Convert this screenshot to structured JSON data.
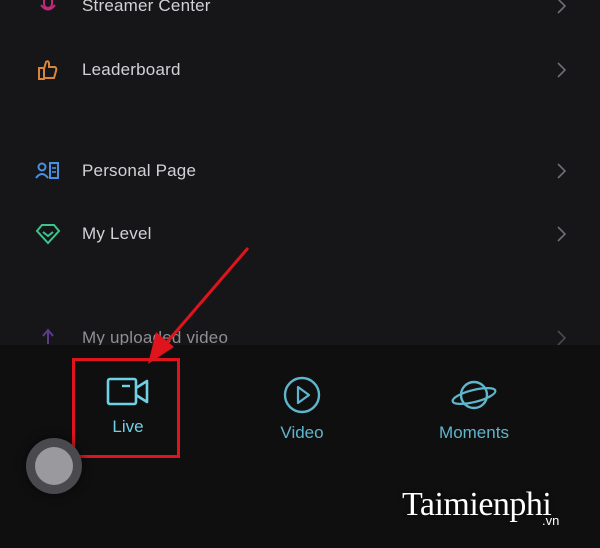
{
  "menu": {
    "items": [
      {
        "label": "Streamer Center",
        "icon": "microphone-icon"
      },
      {
        "label": "Leaderboard",
        "icon": "thumbs-up-icon"
      },
      {
        "label": "Personal Page",
        "icon": "profile-card-icon"
      },
      {
        "label": "My Level",
        "icon": "diamond-icon"
      },
      {
        "label": "My uploaded video",
        "icon": "upload-icon"
      }
    ]
  },
  "tabbar": {
    "tabs": [
      {
        "label": "Live",
        "icon": "video-camera-icon",
        "selected": true
      },
      {
        "label": "Video",
        "icon": "play-circle-icon",
        "selected": false
      },
      {
        "label": "Moments",
        "icon": "planet-icon",
        "selected": false
      }
    ]
  },
  "watermark": {
    "brand": "Taimienphi",
    "domain": ".vn"
  },
  "colors": {
    "background": "#141416",
    "accent": "#5fb6cc",
    "highlight": "#e0141c"
  }
}
